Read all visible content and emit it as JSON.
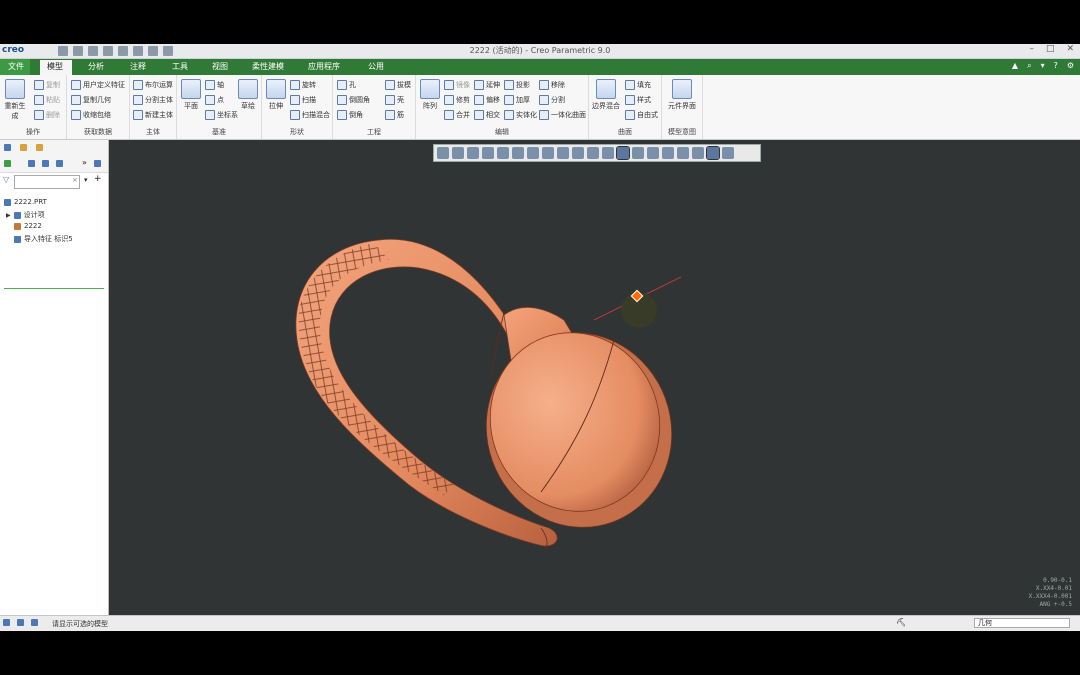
{
  "app": {
    "logo": "creo",
    "window_title": "2222 (活动的) - Creo Parametric 9.0"
  },
  "tabs": {
    "file": "文件",
    "items": [
      "模型",
      "分析",
      "注释",
      "工具",
      "视图",
      "柔性建模",
      "应用程序",
      "公用"
    ]
  },
  "ribbon": {
    "groups": {
      "operations": "操作",
      "get_data": "获取数据",
      "body": "主体",
      "datum": "基准",
      "shapes": "形状",
      "engineering": "工程",
      "editing": "编辑",
      "surfaces": "曲面",
      "model_intent": "模型意图"
    },
    "operations": {
      "regenerate": "重新生成",
      "copy": "复制",
      "paste": "粘贴",
      "delete": "删除"
    },
    "get_data": {
      "udf": "用户定义特征",
      "copy_geometry": "复制几何",
      "shrinkwrap": "收缩包络"
    },
    "body": {
      "boolean": "布尔运算",
      "split_body": "分割主体",
      "new_body": "新建主体"
    },
    "datum": {
      "plane": "平面",
      "axis": "轴",
      "point": "点",
      "csys": "坐标系",
      "sketch": "草绘"
    },
    "shapes": {
      "extrude": "拉伸",
      "revolve": "旋转",
      "sweep": "扫描",
      "swept_blend": "扫描混合"
    },
    "engineering": {
      "hole": "孔",
      "round": "倒圆角",
      "chamfer": "倒角",
      "draft": "拔模",
      "shell": "壳",
      "rib": "筋"
    },
    "editing": {
      "pattern": "阵列",
      "mirror": "镜像",
      "trim": "修剪",
      "merge": "合并",
      "extend": "延伸",
      "offset": "偏移",
      "intersect": "相交",
      "project": "投影",
      "thicken": "加厚",
      "solidify": "实体化",
      "remove": "移除",
      "split": "分割",
      "unify": "一体化曲面"
    },
    "surfaces": {
      "boundary_blend": "边界混合",
      "fill": "填充",
      "style": "样式",
      "freestyle": "自由式"
    },
    "model_intent": {
      "component_interface": "元件界面"
    }
  },
  "tree": {
    "root": "2222.PRT",
    "items": [
      "设计项",
      "2222",
      "导入特征 标识5"
    ]
  },
  "viewport": {
    "coords": [
      "0.90-0.1",
      "X.XX4-0.01",
      "X.XXX4-0.001",
      "ANG +-0.5"
    ]
  },
  "status": {
    "message": "请显示可选的模型",
    "filter_value": "几何"
  },
  "colors": {
    "tabbar": "#2f7a36",
    "viewport_bg": "#303434",
    "model": "#e8926a"
  }
}
